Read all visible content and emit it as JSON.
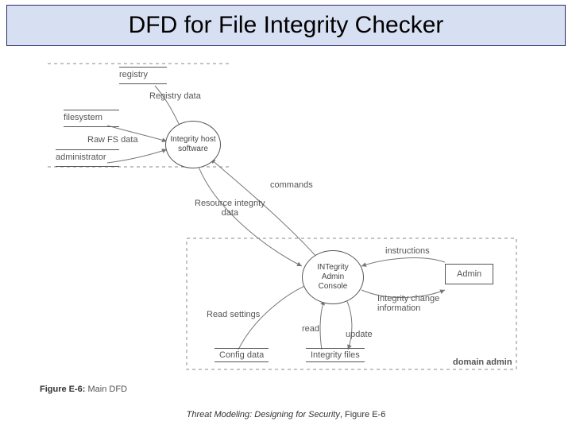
{
  "title": "DFD for File Integrity Checker",
  "diagram": {
    "external_entities": {
      "registry": "registry",
      "filesystem": "filesystem",
      "administrator": "administrator",
      "admin": "Admin",
      "domain_admin": "domain admin"
    },
    "processes": {
      "integrity_host": "Integrity host\nsoftware",
      "admin_console": "INTegrity\nAdmin\nConsole"
    },
    "datastores": {
      "config_data": "Config data",
      "integrity_files": "Integrity files"
    },
    "flows": {
      "registry_data": "Registry data",
      "raw_fs_data": "Raw FS data",
      "commands": "commands",
      "resource_integrity_data": "Resource integrity\ndata",
      "instructions": "instructions",
      "integrity_change_info": "Integrity change\ninformation",
      "read_settings": "Read settings",
      "read": "read",
      "update": "update"
    }
  },
  "figure_caption_bold": "Figure E-6:",
  "figure_caption_rest": " Main DFD",
  "footer_italic": "Threat Modeling: Designing for Security",
  "footer_rest": ", Figure E-6"
}
